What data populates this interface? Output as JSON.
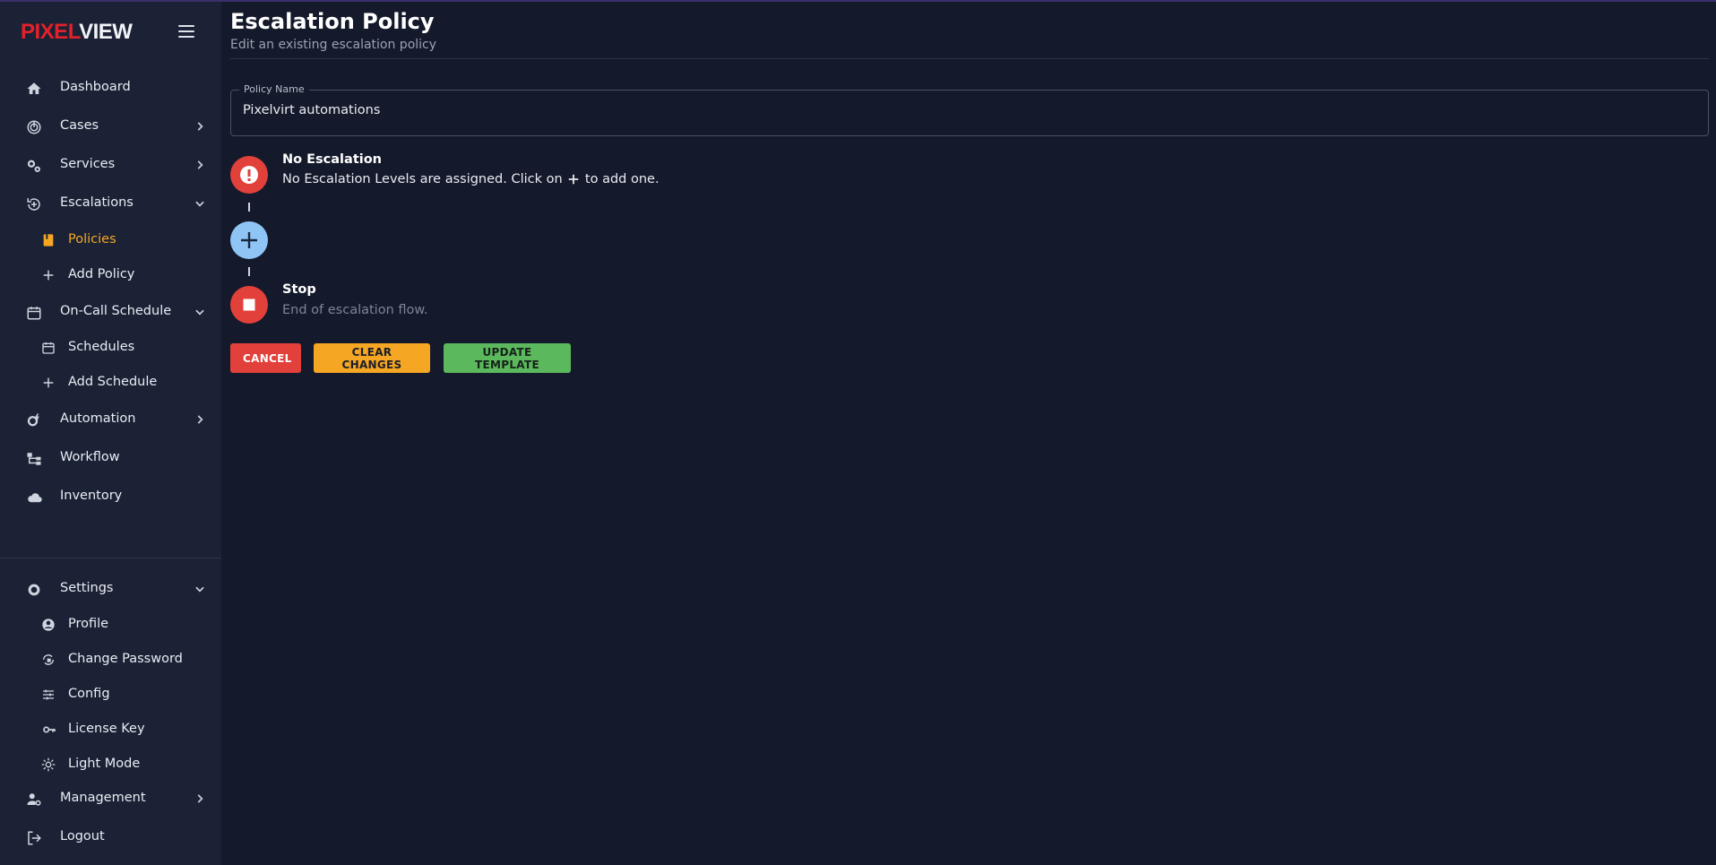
{
  "brand": {
    "part1": "PIXEL",
    "part2": "VIEW",
    "primary_color": "#e3212a"
  },
  "sidebar": {
    "items": [
      {
        "label": "Dashboard",
        "icon": "home-icon"
      },
      {
        "label": "Cases",
        "icon": "fingerprint-icon"
      },
      {
        "label": "Services",
        "icon": "cogs-icon"
      },
      {
        "label": "Escalations",
        "icon": "escalation-icon"
      },
      {
        "label": "On-Call Schedule",
        "icon": "calendar-icon"
      },
      {
        "label": "Automation",
        "icon": "gear-bolt-icon"
      },
      {
        "label": "Workflow",
        "icon": "workflow-icon"
      },
      {
        "label": "Inventory",
        "icon": "cloud-icon"
      }
    ],
    "escalations_sub": [
      {
        "label": "Policies",
        "icon": "book-icon"
      },
      {
        "label": "Add Policy",
        "icon": "plus-icon"
      }
    ],
    "schedule_sub": [
      {
        "label": "Schedules",
        "icon": "calendar-icon"
      },
      {
        "label": "Add Schedule",
        "icon": "plus-icon"
      }
    ],
    "settings": {
      "label": "Settings",
      "icon": "gear-icon"
    },
    "settings_sub": [
      {
        "label": "Profile",
        "icon": "account-circle-icon"
      },
      {
        "label": "Change Password",
        "icon": "lock-reset-icon"
      },
      {
        "label": "Config",
        "icon": "tune-icon"
      },
      {
        "label": "License Key",
        "icon": "key-icon"
      },
      {
        "label": "Light Mode",
        "icon": "sun-icon"
      }
    ],
    "management": {
      "label": "Management",
      "icon": "account-cog-icon"
    },
    "logout": {
      "label": "Logout",
      "icon": "logout-icon"
    }
  },
  "page": {
    "title": "Escalation Policy",
    "subtitle": "Edit an existing escalation policy"
  },
  "form": {
    "policy_name_label": "Policy Name",
    "policy_name_value": "Pixelvirt automations"
  },
  "timeline": {
    "no_escalation_title": "No Escalation",
    "no_escalation_desc_before": "No Escalation Levels are assigned. Click on",
    "no_escalation_desc_after": "to add one.",
    "stop_title": "Stop",
    "stop_desc": "End of escalation flow."
  },
  "buttons": {
    "cancel": "CANCEL",
    "clear": "CLEAR CHANGES",
    "update": "UPDATE TEMPLATE"
  },
  "colors": {
    "accent_active": "#f5a623",
    "danger": "#e2403a",
    "success": "#5cb85c",
    "info": "#8fc5f5"
  }
}
